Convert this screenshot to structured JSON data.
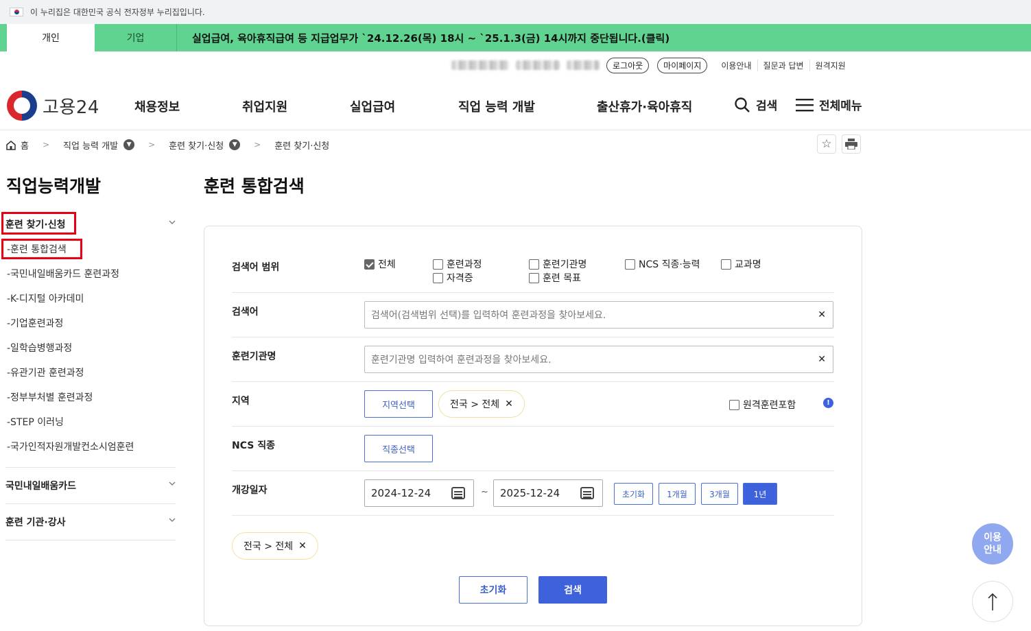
{
  "gov_banner": {
    "text": "이 누리집은 대한민국 공식 전자정부 누리집입니다."
  },
  "notice": {
    "tabs": [
      {
        "label": "개인"
      },
      {
        "label": "기업"
      }
    ],
    "message": "실업급여, 육아휴직급여 등 지급업무가 `24.12.26(목) 18시 ~ `25.1.3(금) 14시까지 중단됩니다.(클릭)"
  },
  "util": {
    "logout": "로그아웃",
    "mypage": "마이페이지",
    "links": [
      "이용안내",
      "질문과 답변",
      "원격지원"
    ]
  },
  "header": {
    "logo": "고용24",
    "nav": [
      "채용정보",
      "취업지원",
      "실업급여",
      "직업 능력 개발",
      "출산휴가·육아휴직"
    ],
    "search_label": "검색",
    "menu_label": "전체메뉴"
  },
  "breadcrumb": {
    "home": "홈",
    "level1": "직업 능력 개발",
    "level2": "훈련 찾기·신청",
    "level3": "훈련 찾기·신청"
  },
  "sidebar": {
    "title": "직업능력개발",
    "section1": "훈련 찾기·신청",
    "items": [
      "-훈련 통합검색",
      "-국민내일배움카드 훈련과정",
      "-K-디지털 아카데미",
      "-기업훈련과정",
      "-일학습병행과정",
      "-유관기관 훈련과정",
      "-정부부처별 훈련과정",
      "-STEP 이러닝",
      "-국가인적자원개발컨소시엄훈련"
    ],
    "section2": "국민내일배움카드",
    "section3": "훈련 기관·강사"
  },
  "main": {
    "title": "훈련 통합검색",
    "scope": {
      "label": "검색어 범위",
      "options": [
        {
          "label": "전체",
          "checked": true
        },
        {
          "label": "훈련과정",
          "checked": false
        },
        {
          "label": "자격증",
          "checked": false
        },
        {
          "label": "훈련기관명",
          "checked": false
        },
        {
          "label": "훈련 목표",
          "checked": false
        },
        {
          "label": "NCS 직종·능력",
          "checked": false
        },
        {
          "label": "교과명",
          "checked": false
        }
      ]
    },
    "keyword": {
      "label": "검색어",
      "placeholder": "검색어(검색범위 선택)를 입력하여 훈련과정을 찾아보세요."
    },
    "institution": {
      "label": "훈련기관명",
      "placeholder": "훈련기관명 입력하여 훈련과정을 찾아보세요."
    },
    "region": {
      "label": "지역",
      "button": "지역선택",
      "chip": "전국 > 전체",
      "remote": "원격훈련포함"
    },
    "ncs": {
      "label": "NCS 직종",
      "button": "직종선택"
    },
    "date": {
      "label": "개강일자",
      "start": "2024-12-24",
      "tilde": "~",
      "end": "2025-12-24",
      "presets": [
        "초기화",
        "1개월",
        "3개월",
        "1년"
      ]
    },
    "selected_chip": "전국 > 전체",
    "reset": "초기화",
    "search": "검색"
  },
  "floating": {
    "guide_line1": "이용",
    "guide_line2": "안내"
  },
  "colors": {
    "notice_bg": "#5fd38f",
    "primary": "#3e61dc",
    "highlight": "#e60012"
  }
}
